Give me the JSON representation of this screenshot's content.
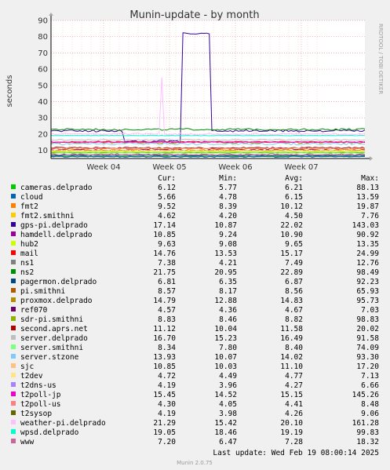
{
  "chart_data": {
    "type": "line",
    "title": "Munin-update - by month",
    "ylabel": "seconds",
    "watermark": "RRDTOOL / TOBI OETIKER",
    "ylim": [
      5,
      90
    ],
    "y_ticks": [
      10,
      20,
      30,
      40,
      50,
      60,
      70,
      80,
      90
    ],
    "x_ticks": [
      "Week 04",
      "Week 05",
      "Week 06",
      "Week 07"
    ],
    "grid": true,
    "legend_headers": [
      "Cur:",
      "Min:",
      "Avg:",
      "Max:"
    ],
    "series": [
      {
        "name": "cameras.delprado",
        "color": "#00cc00",
        "cur": "6.12",
        "min": "5.77",
        "avg": "6.21",
        "max": "88.13"
      },
      {
        "name": "cloud",
        "color": "#0066b3",
        "cur": "5.66",
        "min": "4.78",
        "avg": "6.15",
        "max": "13.59"
      },
      {
        "name": "fmt2",
        "color": "#ff8000",
        "cur": "9.52",
        "min": "8.39",
        "avg": "10.12",
        "max": "19.87"
      },
      {
        "name": "fmt2.smithni",
        "color": "#ffcc00",
        "cur": "4.62",
        "min": "4.20",
        "avg": "4.50",
        "max": "7.76"
      },
      {
        "name": "gps-pi.delprado",
        "color": "#330099",
        "cur": "17.14",
        "min": "10.87",
        "avg": "22.02",
        "max": "143.03"
      },
      {
        "name": "hamdell.delprado",
        "color": "#990099",
        "cur": "10.85",
        "min": "9.24",
        "avg": "10.90",
        "max": "90.92"
      },
      {
        "name": "hub2",
        "color": "#ccff00",
        "cur": "9.63",
        "min": "9.08",
        "avg": "9.65",
        "max": "13.35"
      },
      {
        "name": "mail",
        "color": "#ff0000",
        "cur": "14.76",
        "min": "13.53",
        "avg": "15.17",
        "max": "24.99"
      },
      {
        "name": "ns1",
        "color": "#808080",
        "cur": "7.38",
        "min": "4.21",
        "avg": "7.49",
        "max": "12.76"
      },
      {
        "name": "ns2",
        "color": "#008f00",
        "cur": "21.75",
        "min": "20.95",
        "avg": "22.89",
        "max": "98.49"
      },
      {
        "name": "pagermon.delprado",
        "color": "#00487d",
        "cur": "6.81",
        "min": "6.35",
        "avg": "6.87",
        "max": "92.23"
      },
      {
        "name": "pi.smithni",
        "color": "#b35a00",
        "cur": "8.57",
        "min": "8.17",
        "avg": "8.56",
        "max": "65.93"
      },
      {
        "name": "proxmox.delprado",
        "color": "#b38f00",
        "cur": "14.79",
        "min": "12.88",
        "avg": "14.83",
        "max": "95.73"
      },
      {
        "name": "ref070",
        "color": "#6b006b",
        "cur": "4.57",
        "min": "4.36",
        "avg": "4.67",
        "max": "7.03"
      },
      {
        "name": "sdr-pi.smithni",
        "color": "#8fb300",
        "cur": "8.83",
        "min": "8.46",
        "avg": "8.82",
        "max": "98.83"
      },
      {
        "name": "second.aprs.net",
        "color": "#b30000",
        "cur": "11.12",
        "min": "10.04",
        "avg": "11.58",
        "max": "20.02"
      },
      {
        "name": "server.delprado",
        "color": "#bebebe",
        "cur": "16.70",
        "min": "15.23",
        "avg": "16.49",
        "max": "91.58"
      },
      {
        "name": "server.smithni",
        "color": "#80ff80",
        "cur": "8.34",
        "min": "7.80",
        "avg": "8.40",
        "max": "74.09"
      },
      {
        "name": "server.stzone",
        "color": "#80c9ff",
        "cur": "13.93",
        "min": "10.07",
        "avg": "14.02",
        "max": "93.30"
      },
      {
        "name": "sjc",
        "color": "#ffc080",
        "cur": "10.85",
        "min": "10.03",
        "avg": "11.10",
        "max": "17.20"
      },
      {
        "name": "t2dev",
        "color": "#ffe680",
        "cur": "4.72",
        "min": "4.49",
        "avg": "4.77",
        "max": "7.13"
      },
      {
        "name": "t2dns-us",
        "color": "#aa80ff",
        "cur": "4.19",
        "min": "3.96",
        "avg": "4.27",
        "max": "6.66"
      },
      {
        "name": "t2poll-jp",
        "color": "#ee00cc",
        "cur": "15.45",
        "min": "14.52",
        "avg": "15.15",
        "max": "145.26"
      },
      {
        "name": "t2poll-us",
        "color": "#ff8080",
        "cur": "4.30",
        "min": "4.05",
        "avg": "4.41",
        "max": "8.48"
      },
      {
        "name": "t2sysop",
        "color": "#666600",
        "cur": "4.19",
        "min": "3.98",
        "avg": "4.26",
        "max": "9.06"
      },
      {
        "name": "weather-pi.delprado",
        "color": "#ffbfff",
        "cur": "21.29",
        "min": "15.42",
        "avg": "20.10",
        "max": "161.28"
      },
      {
        "name": "wpsd.delprado",
        "color": "#00ffcc",
        "cur": "19.05",
        "min": "18.46",
        "avg": "19.19",
        "max": "99.83"
      },
      {
        "name": "www",
        "color": "#cc6699",
        "cur": "7.20",
        "min": "6.47",
        "avg": "7.28",
        "max": "18.32"
      }
    ],
    "footer": "Last update: Wed Feb 19 08:00:14 2025",
    "version": "Munin 2.0.75"
  }
}
